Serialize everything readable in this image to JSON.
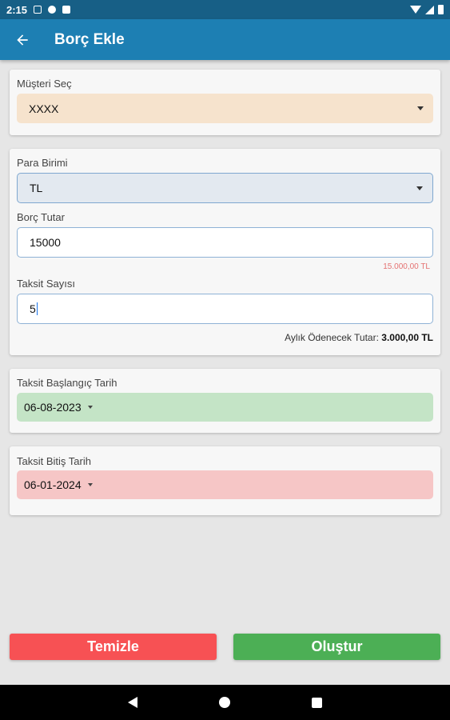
{
  "status_bar": {
    "time": "2:15"
  },
  "app_bar": {
    "title": "Borç Ekle",
    "back_icon": "arrow-left-icon"
  },
  "customer": {
    "label": "Müşteri Seç",
    "value": "XXXX"
  },
  "debt": {
    "currency_label": "Para Birimi",
    "currency_value": "TL",
    "amount_label": "Borç Tutar",
    "amount_value": "15000",
    "amount_formatted": "15.000,00 TL",
    "installments_label": "Taksit Sayısı",
    "installments_value": "5",
    "monthly_label": "Aylık Ödenecek Tutar:",
    "monthly_value": "3.000,00 TL"
  },
  "start_date": {
    "label": "Taksit Başlangıç Tarih",
    "value": "06-08-2023"
  },
  "end_date": {
    "label": "Taksit Bitiş Tarih",
    "value": "06-01-2024"
  },
  "actions": {
    "clear_label": "Temizle",
    "create_label": "Oluştur"
  },
  "colors": {
    "app_bar": "#1d7fb3",
    "clear": "#f75154",
    "create": "#4caf55"
  }
}
